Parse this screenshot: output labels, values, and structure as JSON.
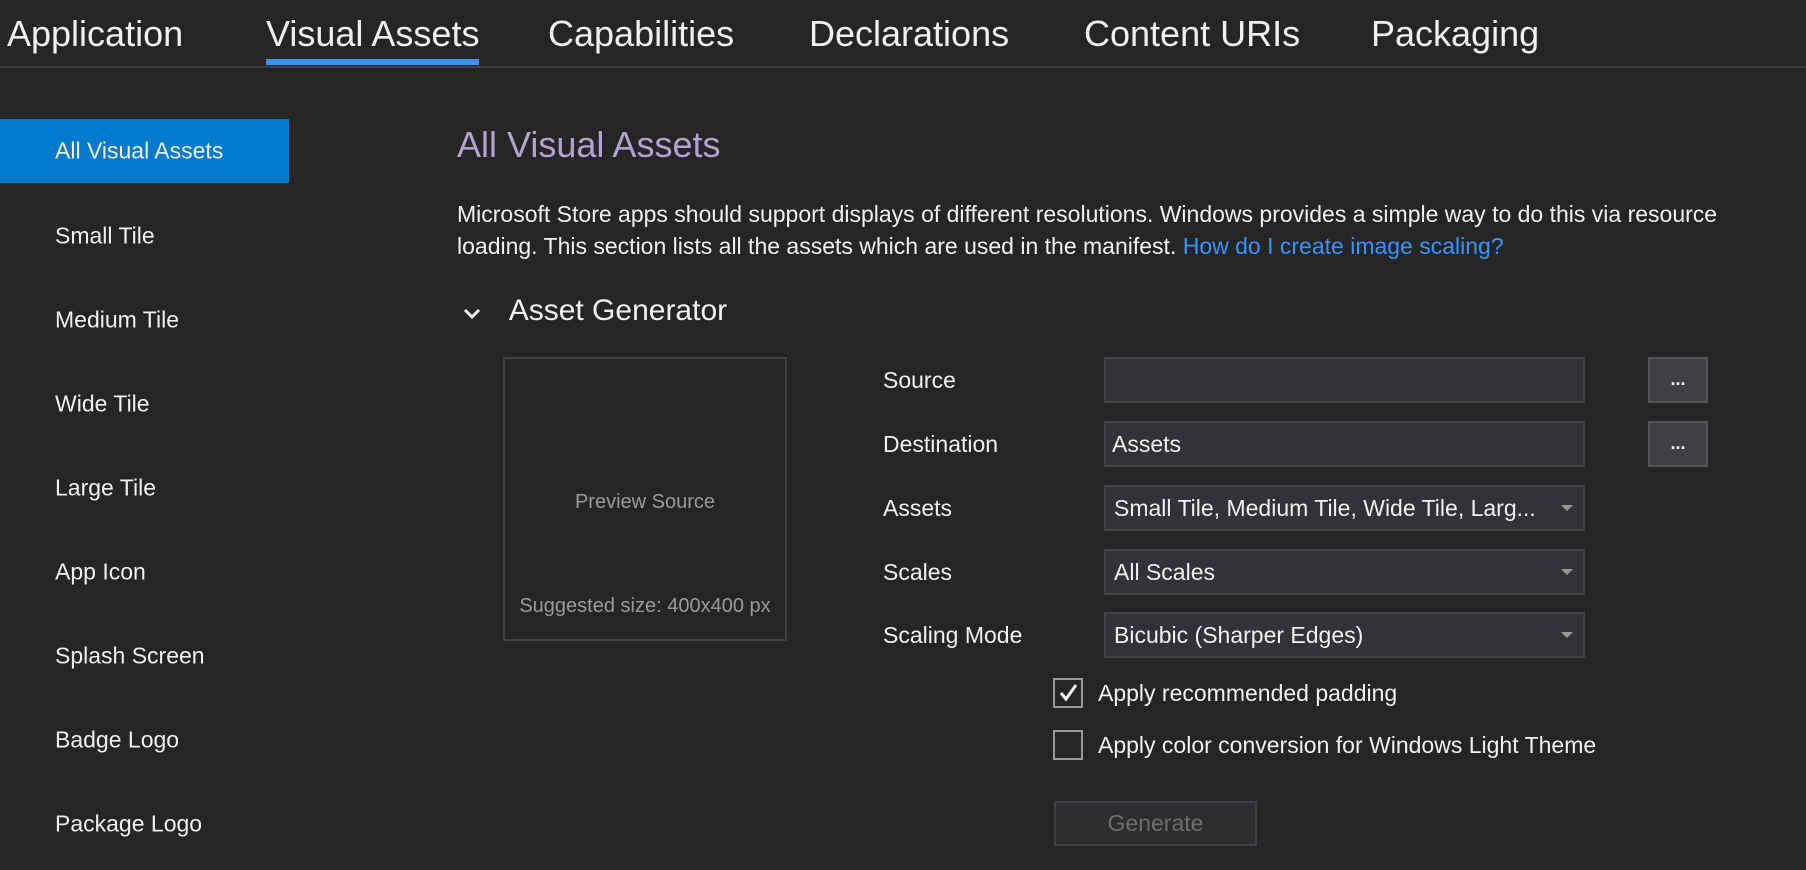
{
  "tabs": [
    {
      "label": "Application",
      "active": false
    },
    {
      "label": "Visual Assets",
      "active": true
    },
    {
      "label": "Capabilities",
      "active": false
    },
    {
      "label": "Declarations",
      "active": false
    },
    {
      "label": "Content URIs",
      "active": false
    },
    {
      "label": "Packaging",
      "active": false
    }
  ],
  "sidebar": {
    "items": [
      {
        "label": "All Visual Assets",
        "active": true
      },
      {
        "label": "Small Tile"
      },
      {
        "label": "Medium Tile"
      },
      {
        "label": "Wide Tile"
      },
      {
        "label": "Large Tile"
      },
      {
        "label": "App Icon"
      },
      {
        "label": "Splash Screen"
      },
      {
        "label": "Badge Logo"
      },
      {
        "label": "Package Logo"
      }
    ]
  },
  "main": {
    "title": "All Visual Assets",
    "description": "Microsoft Store apps should support displays of different resolutions. Windows provides a simple way to do this via resource loading. This section lists all the assets which are used in the manifest.",
    "help_link": "How do I create image scaling?",
    "section": {
      "title": "Asset Generator",
      "expanded": true,
      "chevron_icon": "chevron-down-icon"
    },
    "preview": {
      "label": "Preview Source",
      "hint": "Suggested size: 400x400 px"
    },
    "form": {
      "source": {
        "label": "Source",
        "value": "",
        "browse_label": "..."
      },
      "destination": {
        "label": "Destination",
        "value": "Assets",
        "browse_label": "..."
      },
      "assets": {
        "label": "Assets",
        "value": "Small Tile, Medium Tile, Wide Tile, Larg..."
      },
      "scales": {
        "label": "Scales",
        "value": "All Scales"
      },
      "scaling_mode": {
        "label": "Scaling Mode",
        "value": "Bicubic (Sharper Edges)"
      },
      "padding_checkbox": {
        "label": "Apply recommended padding",
        "checked": true
      },
      "color_checkbox": {
        "label": "Apply color conversion for Windows Light Theme",
        "checked": false
      },
      "generate_label": "Generate",
      "generate_enabled": false
    }
  },
  "colors": {
    "background": "#252526",
    "accent": "#007acc",
    "tab_underline": "#3794ff",
    "title": "#b4a0d2",
    "link": "#3794ff"
  }
}
